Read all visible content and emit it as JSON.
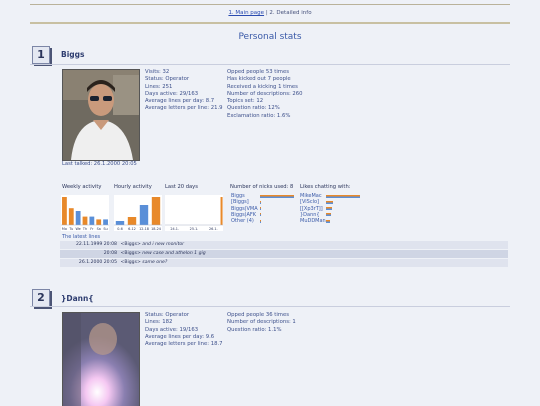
{
  "nav": {
    "main_page": "1. Main page",
    "divider": "|",
    "detailed": "2. Detailed info"
  },
  "page_title": "Personal stats",
  "colors": {
    "background": "#eef1f7",
    "bar_orange": "#e8892a",
    "bar_blue": "#5a8fd8",
    "bar_yellow": "#e9c552"
  },
  "users": [
    {
      "rank": "1",
      "name": "Biggs",
      "photo": "photo of a person with sunglasses",
      "stats_left": [
        "Visits: 32",
        "Status: Operator",
        "Lines: 251",
        "Days active: 29/163",
        "Average lines per day: 8.7",
        "Average letters per line: 21.9"
      ],
      "stats_right": [
        "Opped people 53 times",
        "Has kicked out 7 people",
        "Received a kicking 1 times",
        "Number of descriptions: 260",
        "Topics set: 12",
        "Question ratio: 12%",
        "Exclamation ratio: 1.6%"
      ],
      "last_talked": "Last talked: 26.1.2000 20:05",
      "weekly_label": "Weekly activity",
      "hourly_label": "Hourly activity",
      "last20_label": "Last 20 days",
      "nicks_label": "Number of nicks used: 8",
      "likes_label": "Likes chatting with:",
      "weekly_days": [
        "Mo",
        "Tu",
        "We",
        "Th",
        "Fr",
        "Sa",
        "Su"
      ],
      "weekly_values": [
        10,
        6,
        5,
        3,
        3,
        2,
        2
      ],
      "hourly_ticks": [
        "0-6",
        "6-12",
        "12-18",
        "18-24"
      ],
      "hourly_values": [
        1,
        2,
        5,
        7
      ],
      "last20_ticks": [
        "24.1.",
        "25.1.",
        "26.1."
      ],
      "last20_values": [
        0,
        0,
        0,
        0,
        0,
        0,
        0,
        0,
        0,
        0,
        0,
        0,
        0,
        0,
        0,
        0,
        0,
        0,
        0,
        14
      ],
      "nicks": [
        "Biggs",
        "[Biggs]",
        "Biggs|VMA",
        "Biggs|AFK",
        "Other (4)"
      ],
      "nick_values": [
        95,
        3,
        1,
        1,
        1
      ],
      "likes": [
        "MikeMac",
        "[ViSclo]",
        "[[Xp3rT]]",
        "}Dann{",
        "MuDDMan"
      ],
      "like_values": [
        100,
        20,
        18,
        16,
        12
      ],
      "latest_title": "The latest lines",
      "latest": [
        {
          "time": "22.11.1999 20:08",
          "nick": "<Biggs>",
          "text": "and i new monitor"
        },
        {
          "time": "20:08",
          "nick": "<Biggs>",
          "text": "new case and athelon 1 gig"
        },
        {
          "time": "26.1.2000 20:05",
          "nick": "<Biggs>",
          "text": "same one?"
        }
      ]
    },
    {
      "rank": "2",
      "name": "}Dann{",
      "photo": "blurry photo with a flash glare",
      "stats_left": [
        "Status: Operator",
        "Lines: 182",
        "Days active: 19/163",
        "Average lines per day: 9.6",
        "Average letters per line: 18.7"
      ],
      "stats_right": [
        "Opped people 36 times",
        "Number of descriptions: 1",
        "Question ratio: 1.1%"
      ]
    }
  ]
}
